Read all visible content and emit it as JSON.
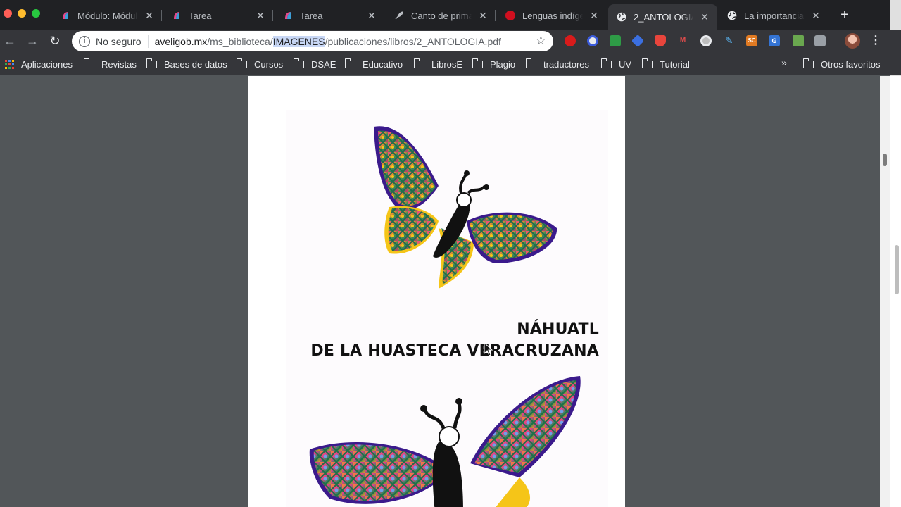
{
  "tabs": [
    {
      "label": "Módulo: Módulo",
      "active": false,
      "favicon": "canvas-icon"
    },
    {
      "label": "Tarea",
      "active": false,
      "favicon": "canvas-icon"
    },
    {
      "label": "Tarea",
      "active": false,
      "favicon": "canvas-icon"
    },
    {
      "label": "Canto de primav",
      "active": false,
      "favicon": "feather-icon"
    },
    {
      "label": "Lenguas indígen",
      "active": false,
      "favicon": "red-circle-icon"
    },
    {
      "label": "2_ANTOLOGIA.p",
      "active": true,
      "favicon": "globe-icon"
    },
    {
      "label": "La importancia d",
      "active": false,
      "favicon": "globe-icon"
    }
  ],
  "omnibox": {
    "security_label": "No seguro",
    "url_host": "aveligob.mx",
    "url_pre": "/ms_biblioteca/",
    "url_highlight": "IMAGENES",
    "url_post": "/publicaciones/libros/2_ANTOLOGIA.pdf"
  },
  "bookmarks": {
    "apps_label": "Aplicaciones",
    "items": [
      "Revistas",
      "Bases de datos",
      "Cursos",
      "DSAE",
      "Educativo",
      "LibrosE",
      "Plagio",
      "traductores",
      "UV",
      "Tutorial"
    ],
    "overflow_label": "»",
    "other_label": "Otros favoritos"
  },
  "document": {
    "title_line1": "NÁHUATL",
    "title_line2": "DE LA HUASTECA VERACRUZANA"
  },
  "colors": {
    "chrome_dark": "#202124",
    "toolbar": "#35363a",
    "viewer_bg": "#525659",
    "butterfly_purple": "#3b1a8c",
    "butterfly_yellow": "#f5c518"
  }
}
